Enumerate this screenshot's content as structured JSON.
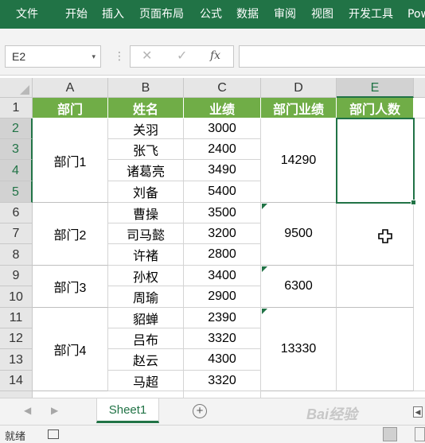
{
  "ribbon": {
    "tabs": [
      "文件",
      "开始",
      "插入",
      "页面布局",
      "公式",
      "数据",
      "审阅",
      "视图",
      "开发工具",
      "Pow"
    ]
  },
  "formula_bar": {
    "name_box": "E2",
    "name_box_caret": "▾",
    "separator": "⋮",
    "cancel_glyph": "✕",
    "enter_glyph": "✓",
    "fx_label": "fx",
    "formula": ""
  },
  "columns": [
    "A",
    "B",
    "C",
    "D",
    "E"
  ],
  "rows": [
    "1",
    "2",
    "3",
    "4",
    "5",
    "6",
    "7",
    "8",
    "9",
    "10",
    "11",
    "12",
    "13",
    "14"
  ],
  "header_row": [
    "部门",
    "姓名",
    "业绩",
    "部门业绩",
    "部门人数"
  ],
  "departments": [
    {
      "name": "部门1",
      "total": "14290",
      "count": ""
    },
    {
      "name": "部门2",
      "total": "9500",
      "count": ""
    },
    {
      "name": "部门3",
      "total": "6300",
      "count": ""
    },
    {
      "name": "部门4",
      "total": "13330",
      "count": ""
    }
  ],
  "people": [
    {
      "name": "关羽",
      "score": "3000"
    },
    {
      "name": "张飞",
      "score": "2400"
    },
    {
      "name": "诸葛亮",
      "score": "3490"
    },
    {
      "name": "刘备",
      "score": "5400"
    },
    {
      "name": "曹操",
      "score": "3500"
    },
    {
      "name": "司马懿",
      "score": "3200"
    },
    {
      "name": "许褚",
      "score": "2800"
    },
    {
      "name": "孙权",
      "score": "3400"
    },
    {
      "name": "周瑜",
      "score": "2900"
    },
    {
      "name": "貂蝉",
      "score": "2390"
    },
    {
      "name": "吕布",
      "score": "3320"
    },
    {
      "name": "赵云",
      "score": "4300"
    },
    {
      "name": "马超",
      "score": "3320"
    }
  ],
  "sheet_bar": {
    "prev_glyph": "◀",
    "next_glyph": "▶",
    "active_sheet": "Sheet1",
    "add_glyph": "+",
    "scroll_glyph": "◀"
  },
  "status_bar": {
    "ready": "就绪"
  },
  "watermark": "Bai经验",
  "colors": {
    "ribbon": "#217346",
    "header_fill": "#70ad47",
    "selection": "#217346"
  }
}
